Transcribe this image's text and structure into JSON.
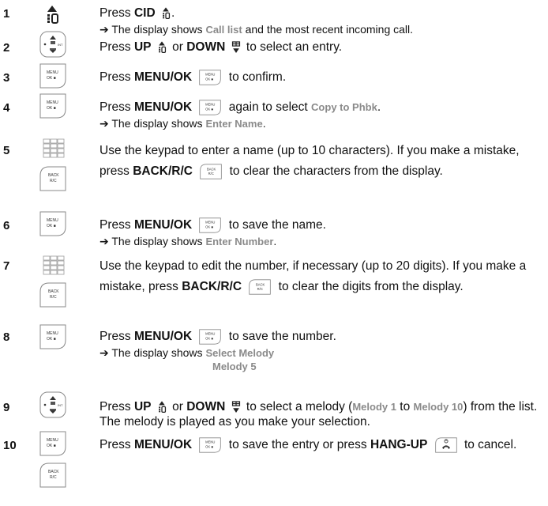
{
  "steps": [
    {
      "n": "1"
    },
    {
      "n": "2"
    },
    {
      "n": "3"
    },
    {
      "n": "4"
    },
    {
      "n": "5"
    },
    {
      "n": "6"
    },
    {
      "n": "7"
    },
    {
      "n": "8"
    },
    {
      "n": "9"
    },
    {
      "n": "10"
    }
  ],
  "text": {
    "press": "Press",
    "cid": "CID",
    "period": ".",
    "arrow": "➔",
    "display_shows": "The display shows",
    "call_list": "Call list",
    "and_recent": "and the most recent incoming call.",
    "up": "UP",
    "or": "or",
    "down": "DOWN",
    "to_select_entry": "to select an entry.",
    "menu_ok": "MENU/OK",
    "to_confirm": "to confirm.",
    "again_select": "again to select",
    "copy_to_phbk": "Copy to Phbk",
    "enter_name": "Enter Name",
    "s5_a": "Use the keypad to enter a name (up to 10 characters). If you make a mistake, press",
    "back_rc": "BACK/R/C",
    "s5_b": "to clear the characters from the display.",
    "to_save_name": "to save the name.",
    "enter_number": "Enter Number",
    "s7_a": "Use the keypad to edit the number, if necessary (up to 20 digits). If you make a mistake, press",
    "s7_b": "to clear the digits from the display.",
    "to_save_number": "to save the number.",
    "select_melody": "Select Melody",
    "melody_5": "Melody 5",
    "s9_a": "to select a melody (",
    "melody_1": "Melody 1",
    "to": "to",
    "melody_10": "Melody 10",
    "s9_b": ") from the list. The melody is played as you make your selection.",
    "s10_a": "to save the entry or press",
    "hang_up": "HANG-UP",
    "s10_b": "to cancel."
  },
  "keys": {
    "menu_top": "MENU",
    "menu_bottom": "OK ■",
    "back_top": "BACK",
    "back_bottom": "R/C",
    "int": "INT"
  }
}
